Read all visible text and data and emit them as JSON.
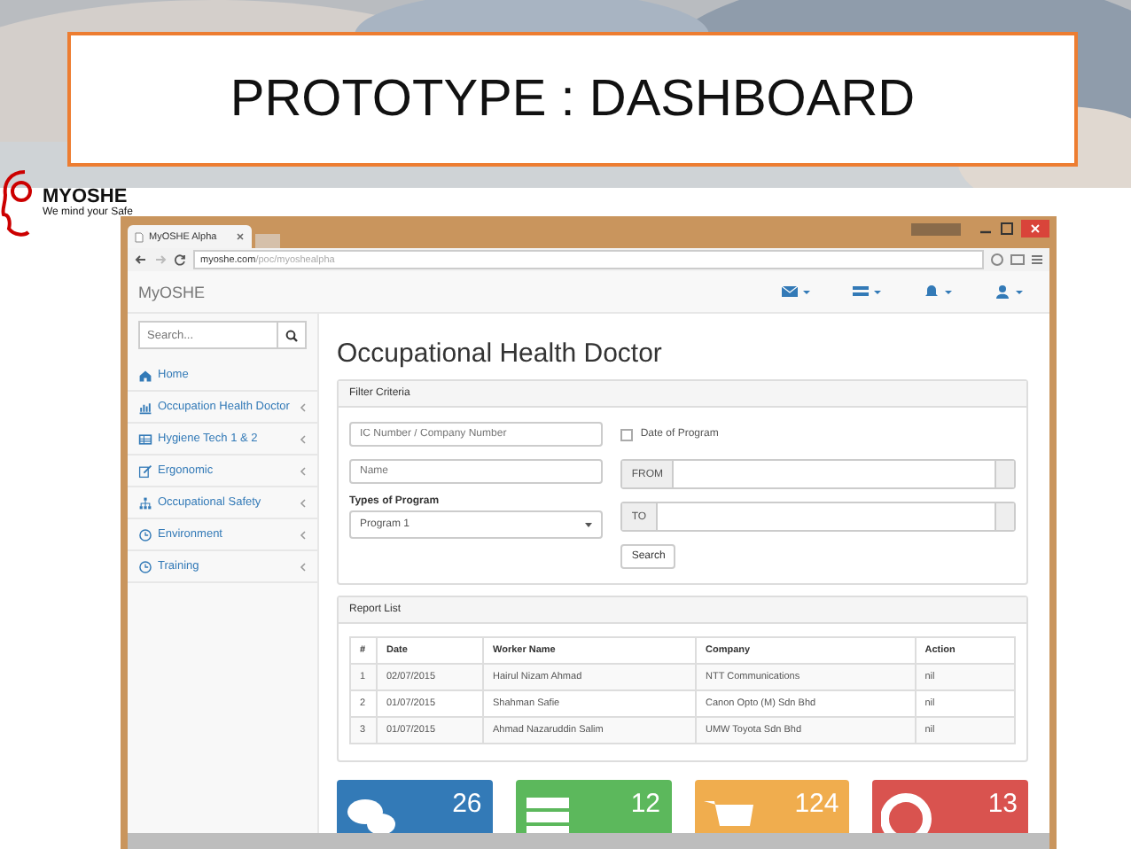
{
  "slide": {
    "title": "PROTOTYPE : DASHBOARD",
    "logo": {
      "name": "MYOSHE",
      "tagline": "We mind your Safe"
    }
  },
  "browser": {
    "tab": "MyOSHE Alpha",
    "url_host": "myoshe.com",
    "url_path": "/poc/myoshealpha"
  },
  "app": {
    "brand": "MyOSHE"
  },
  "sidebar": {
    "search_placeholder": "Search...",
    "items": [
      {
        "label": "Home",
        "expandable": false
      },
      {
        "label": "Occupation Health Doctor",
        "expandable": true
      },
      {
        "label": "Hygiene Tech 1 & 2",
        "expandable": true
      },
      {
        "label": "Ergonomic",
        "expandable": true
      },
      {
        "label": "Occupational Safety",
        "expandable": true
      },
      {
        "label": "Environment",
        "expandable": true
      },
      {
        "label": "Training",
        "expandable": true
      }
    ]
  },
  "page": {
    "heading": "Occupational Health Doctor"
  },
  "filter": {
    "title": "Filter Criteria",
    "ic_placeholder": "IC Number / Company Number",
    "name_placeholder": "Name",
    "program_label": "Types of Program",
    "program_value": "Program 1",
    "date_checkbox": {
      "label": "Date of Program",
      "checked": false
    },
    "from_label": "FROM",
    "to_label": "TO",
    "search_button": "Search"
  },
  "report": {
    "title": "Report List",
    "columns": [
      "#",
      "Date",
      "Worker Name",
      "Company",
      "Action"
    ],
    "rows": [
      [
        "1",
        "02/07/2015",
        "Hairul Nizam Ahmad",
        "NTT Communications",
        "nil"
      ],
      [
        "2",
        "01/07/2015",
        "Shahman Safie",
        "Canon Opto (M) Sdn Bhd",
        "nil"
      ],
      [
        "3",
        "01/07/2015",
        "Ahmad Nazaruddin Salim",
        "UMW Toyota Sdn Bhd",
        "nil"
      ]
    ]
  },
  "tiles": [
    {
      "count": "26",
      "color": "#337ab7"
    },
    {
      "count": "12",
      "color": "#5cb85c"
    },
    {
      "count": "124",
      "color": "#f0ad4e"
    },
    {
      "count": "13",
      "color": "#d9534f"
    }
  ]
}
